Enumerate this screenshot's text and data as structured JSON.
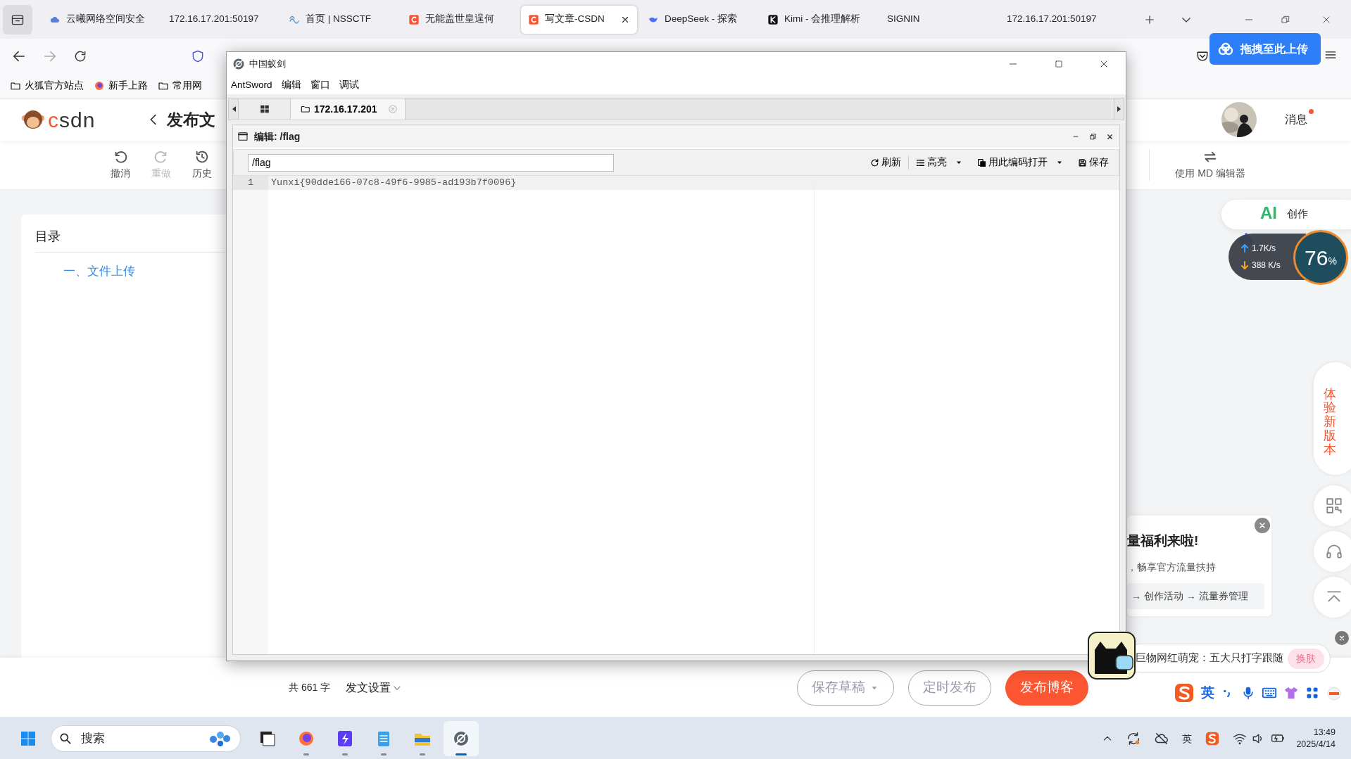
{
  "browser": {
    "tabs": [
      {
        "kind": "cloud",
        "title": "云曦网络空间安全",
        "selected": false
      },
      {
        "kind": "none",
        "title": "172.16.17.201:50197",
        "selected": false
      },
      {
        "kind": "nss",
        "title": "首页 | NSSCTF",
        "selected": false
      },
      {
        "kind": "csdn",
        "title": "无能盖世皇逞何",
        "selected": false
      },
      {
        "kind": "csdn",
        "title": "写文章-CSDN",
        "selected": true
      },
      {
        "kind": "deepseek",
        "title": "DeepSeek - 探索",
        "selected": false
      },
      {
        "kind": "kimi",
        "title": "Kimi - 会推理解析",
        "selected": false
      },
      {
        "kind": "none",
        "title": "SIGNIN",
        "selected": false
      },
      {
        "kind": "none",
        "title": "172.16.17.201:50197",
        "selected": false
      }
    ],
    "bookmarks": [
      {
        "kind": "folder",
        "label": "火狐官方站点"
      },
      {
        "kind": "firefox",
        "label": "新手上路"
      },
      {
        "kind": "folder",
        "label": "常用网"
      }
    ],
    "upload_button": "拖拽至此上传"
  },
  "csdn": {
    "logo": "csdn",
    "page_title": "发布文",
    "messages": {
      "label": "消息",
      "unread": true
    },
    "toolbar": [
      {
        "kind": "undo",
        "label": "撤消",
        "disabled": false
      },
      {
        "kind": "redo",
        "label": "重做",
        "disabled": true
      },
      {
        "kind": "history",
        "label": "历史",
        "disabled": false
      }
    ],
    "md_editor": "使用 MD 编辑器",
    "toc": {
      "title": "目录",
      "items": [
        "一、文件上传"
      ]
    },
    "word_count": "共 661 字",
    "publish_settings": "发文设置",
    "actions": [
      {
        "kind": "dropdown",
        "label": "保存草稿"
      },
      {
        "kind": "outline",
        "label": "定时发布"
      },
      {
        "kind": "primary",
        "label": "发布博客"
      }
    ],
    "ai_badge": {
      "title": "AI",
      "label": "创作"
    },
    "new_version": "体验新版本",
    "promo": {
      "title": "量福利来啦!",
      "text": "，畅享官方流量扶持",
      "path": "→ 创作活动 → 流量券管理"
    }
  },
  "antsword": {
    "title": "中国蚁剑",
    "menu": [
      "AntSword",
      "编辑",
      "窗口",
      "调试"
    ],
    "tabs": [
      {
        "label": "172.16.17.201",
        "selected": true
      }
    ],
    "panel": {
      "title": "编辑: /flag",
      "path": "/flag",
      "tools": [
        {
          "kind": "refresh",
          "label": "刷新",
          "dropdown": false
        },
        {
          "kind": "list",
          "label": "高亮",
          "dropdown": true
        },
        {
          "kind": "encoding",
          "label": "用此编码打开",
          "dropdown": true
        },
        {
          "kind": "save",
          "label": "保存",
          "dropdown": false
        }
      ],
      "lines": [
        {
          "number": "1",
          "text": "Yunxi{90dde166-07c8-49f6-9985-ad193b7f0096}",
          "current": true
        }
      ]
    }
  },
  "network_monitor": {
    "upload": "1.7K/s",
    "download": "388 K/s",
    "percent": "76",
    "unit": "%"
  },
  "ime": {
    "skin_text": "巨物网红萌宠：五大只打字跟随",
    "skin_button": "换肤",
    "language": "英"
  },
  "taskbar": {
    "search_placeholder": "搜索",
    "apps": [
      {
        "kind": "taskview",
        "running": false,
        "selected": false
      },
      {
        "kind": "firefox",
        "running": true,
        "selected": false
      },
      {
        "kind": "bolt",
        "running": true,
        "selected": false
      },
      {
        "kind": "notepad",
        "running": true,
        "selected": false
      },
      {
        "kind": "explorer",
        "running": true,
        "selected": false
      },
      {
        "kind": "antsword",
        "running": true,
        "selected": true
      }
    ],
    "tray_ime": "英",
    "time": "13:49",
    "date": "2025/4/14"
  }
}
